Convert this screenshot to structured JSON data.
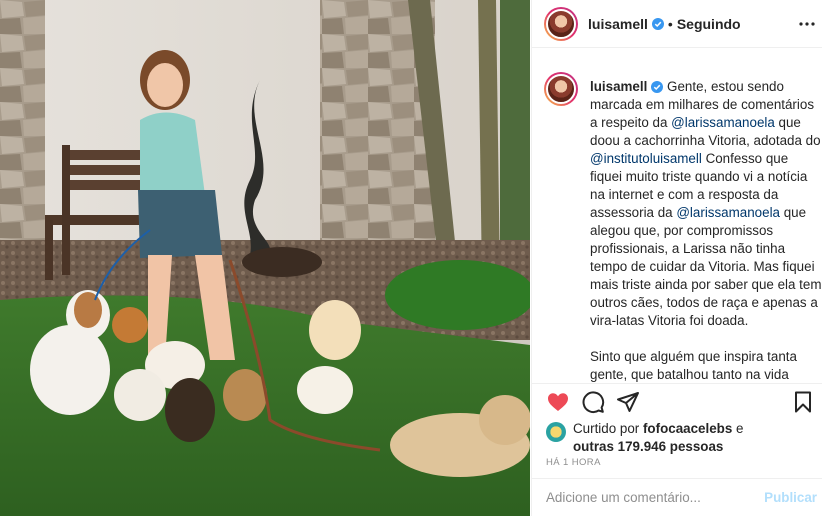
{
  "post": {
    "image_alt": "Menina com vários cachorros no quintal"
  },
  "header": {
    "username": "luisamell",
    "separator": "•",
    "follow_status": "Seguindo"
  },
  "caption": {
    "username": "luisamell",
    "p1_a": " Gente, estou sendo marcada em milhares de comentários a respeito da ",
    "mention1": "@larissamanoela",
    "p1_b": " que doou a cachorrinha Vitoria, adotada do ",
    "mention2": "@institutoluisamell",
    "p1_c": " Confesso que fiquei muito triste quando vi a notícia na internet e com a resposta da assessoria da ",
    "mention3": "@larissamanoela",
    "p1_d": " que alegou que, por compromissos profissionais, a Larissa não tinha tempo de cuidar da Vitoria. Mas fiquei mais triste ainda por saber que ela tem outros cães, todos de raça e apenas a vira-latas Vitoria foi doada.",
    "p2": "Sinto que alguém que inspira tanta gente, que batalhou tanto na vida trabalhando desde cedo para chegar aonde chegou, dê esse exemplo quando se trata de uma vida. Adotar um"
  },
  "likes": {
    "prefix": "Curtido por ",
    "user": "fofocaacelebs",
    "middle": " e",
    "count": "outras 179.946 pessoas"
  },
  "time": "HÁ 1 HORA",
  "comment": {
    "placeholder": "Adicione um comentário...",
    "publish_label": "Publicar"
  },
  "colors": {
    "like_red": "#ed4956",
    "verified_blue": "#3897f0",
    "mention_blue": "#00376b",
    "publish_disabled": "#b2dffc"
  }
}
